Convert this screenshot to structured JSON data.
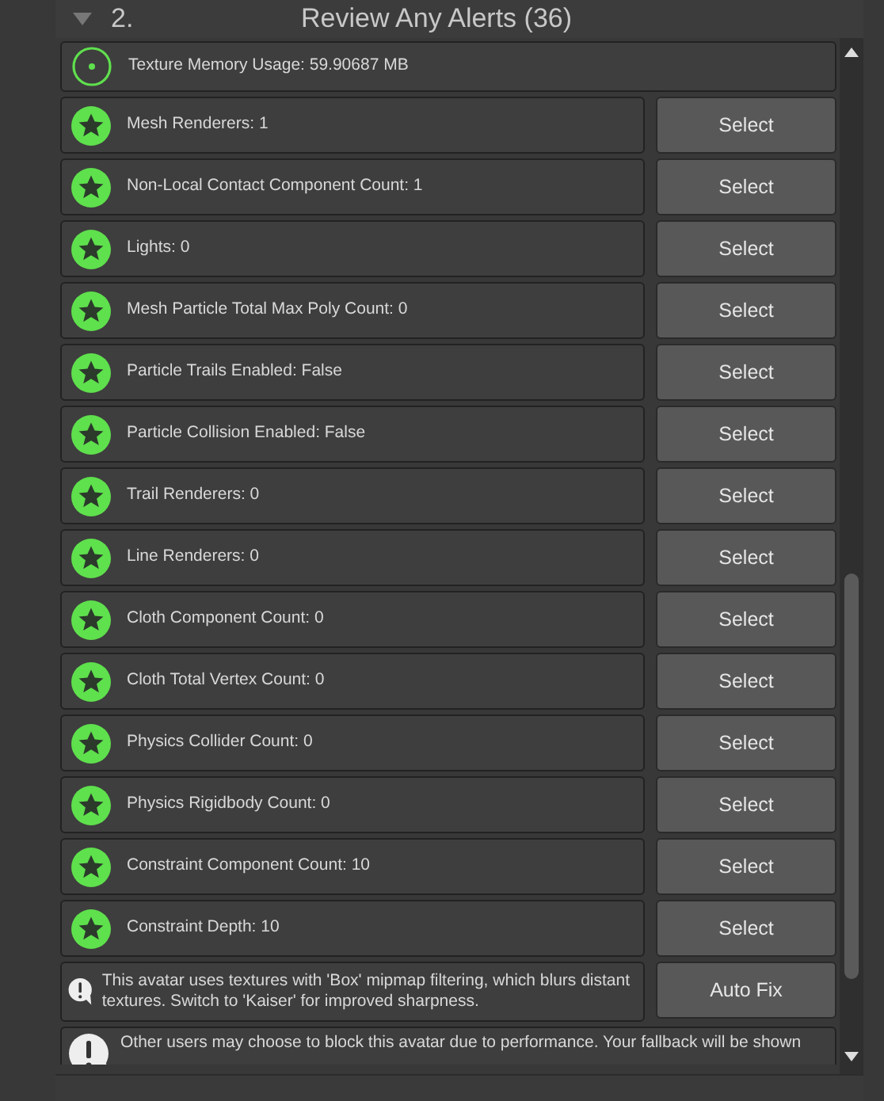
{
  "header": {
    "expanded": true,
    "number": "2.",
    "title": "Review Any Alerts (36)"
  },
  "items": [
    {
      "kind": "info",
      "text": "Texture Memory Usage: 59.90687 MB"
    },
    {
      "kind": "ok",
      "text": "Mesh Renderers: 1",
      "action": "Select"
    },
    {
      "kind": "ok",
      "text": "Non-Local Contact Component Count: 1",
      "action": "Select"
    },
    {
      "kind": "ok",
      "text": "Lights: 0",
      "action": "Select"
    },
    {
      "kind": "ok",
      "text": "Mesh Particle Total Max Poly Count: 0",
      "action": "Select"
    },
    {
      "kind": "ok",
      "text": "Particle Trails Enabled: False",
      "action": "Select"
    },
    {
      "kind": "ok",
      "text": "Particle Collision Enabled: False",
      "action": "Select"
    },
    {
      "kind": "ok",
      "text": "Trail Renderers: 0",
      "action": "Select"
    },
    {
      "kind": "ok",
      "text": "Line Renderers: 0",
      "action": "Select"
    },
    {
      "kind": "ok",
      "text": "Cloth Component Count: 0",
      "action": "Select"
    },
    {
      "kind": "ok",
      "text": "Cloth Total Vertex Count: 0",
      "action": "Select"
    },
    {
      "kind": "ok",
      "text": "Physics Collider Count: 0",
      "action": "Select"
    },
    {
      "kind": "ok",
      "text": "Physics Rigidbody Count: 0",
      "action": "Select"
    },
    {
      "kind": "ok",
      "text": "Constraint Component Count: 10",
      "action": "Select"
    },
    {
      "kind": "ok",
      "text": "Constraint Depth: 10",
      "action": "Select"
    },
    {
      "kind": "warning",
      "text": "This avatar uses textures with 'Box' mipmap filtering, which blurs distant textures. Switch to 'Kaiser' for improved sharpness.",
      "action": "Auto Fix"
    },
    {
      "kind": "warning",
      "text": "Other users may choose to block this avatar due to performance. Your fallback will be shown"
    }
  ]
}
